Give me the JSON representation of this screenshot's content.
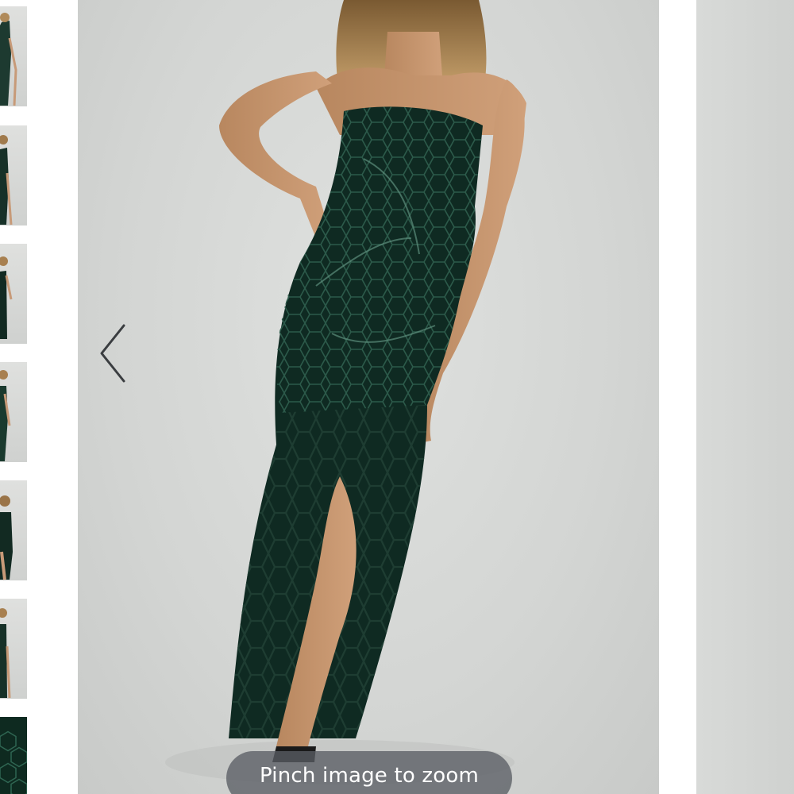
{
  "gallery": {
    "thumbnails": [
      {
        "label": "thumbnail 1"
      },
      {
        "label": "thumbnail 2"
      },
      {
        "label": "thumbnail 3"
      },
      {
        "label": "thumbnail 4"
      },
      {
        "label": "thumbnail 5"
      },
      {
        "label": "thumbnail 6"
      },
      {
        "label": "thumbnail 7"
      }
    ],
    "prev_icon": "chevron-left-icon",
    "zoom_hint": "Pinch image to zoom"
  },
  "colors": {
    "background": "#ffffff",
    "photo_backdrop": "#d6d8d6",
    "dress": "#0f2a22",
    "zoom_hint_bg": "#5a5e64",
    "zoom_hint_text": "#ffffff"
  }
}
